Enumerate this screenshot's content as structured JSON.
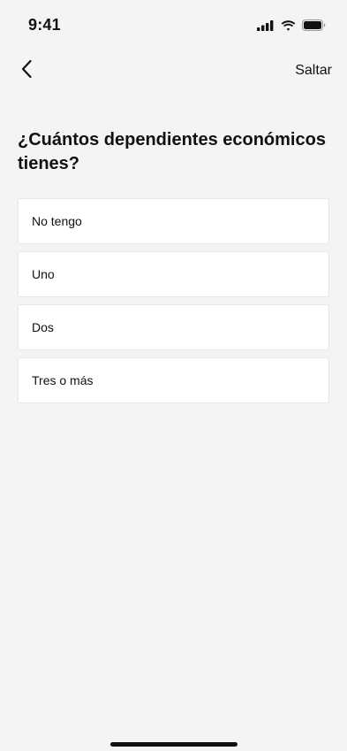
{
  "status_bar": {
    "time": "9:41",
    "icons": [
      "cellular-signal-icon",
      "wifi-icon",
      "battery-icon"
    ]
  },
  "nav": {
    "back_icon": "chevron-left-icon",
    "skip_label": "Saltar"
  },
  "question": "¿Cuántos dependientes económicos tienes?",
  "options": [
    {
      "label": "No tengo"
    },
    {
      "label": "Uno"
    },
    {
      "label": "Dos"
    },
    {
      "label": "Tres o más"
    }
  ],
  "colors": {
    "background": "#f4f4f4",
    "card": "#ffffff",
    "card_border": "#e6e6e6",
    "text": "#111111"
  }
}
